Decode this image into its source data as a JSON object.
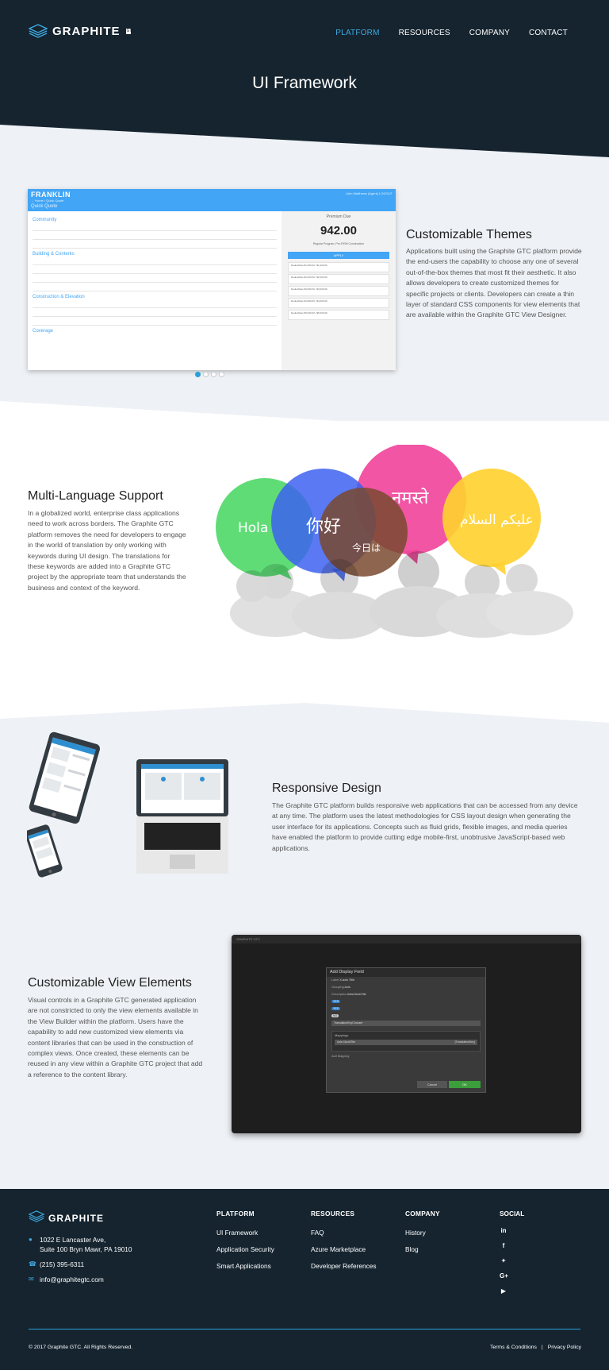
{
  "header": {
    "logo_text": "GRAPHITE",
    "logo_badge": "GTC",
    "nav": [
      "PLATFORM",
      "RESOURCES",
      "COMPANY",
      "CONTACT"
    ],
    "active_nav": "PLATFORM",
    "title": "UI Framework"
  },
  "themes": {
    "heading": "Customizable Themes",
    "body": "Applications built using the Graphite GTC platform provide the end-users the capability to choose any one of several out-of-the-box themes that most fit their aesthetic. It also allows developers to create customized themes for specific projects or clients. Developers can create a thin layer of standard CSS components for view elements that are available within the Graphite GTC View Designer.",
    "screen": {
      "brand": "FRANKLIN",
      "breadcrumb": "← Home / Quick Quote",
      "page": "Quick Quote",
      "user": "John Matthews (Agent)  LOGOUT",
      "sections": [
        "Community",
        "Building & Contents",
        "Construction & Elevation",
        "Coverage"
      ],
      "premium_label": "Premium Due",
      "premium_value": "942.00",
      "program": "Regular Program, Pre-FIRM Construction",
      "apply": "APPLY",
      "cards": [
        "Deductibles $1,000.00 / $1,000.00",
        "Deductibles $2,000.00 / $2,000.00",
        "Deductibles $3,000.00 / $3,000.00",
        "Deductibles $4,000.00 / $4,000.00",
        "Deductibles $5,000.00 / $5,000.00"
      ]
    },
    "carousel_active": 0,
    "carousel_count": 4
  },
  "language": {
    "heading": "Multi-Language Support",
    "body": "In a globalized world, enterprise class applications need to work across borders. The Graphite GTC platform removes the need for developers to engage in the world of translation by only working with keywords during UI design. The translations for these keywords are added into a Graphite GTC project by the appropriate team that understands the business and context of the keyword.",
    "bubbles": [
      "Hola",
      "你好",
      "今日は",
      "नमस्ते",
      "عليكم السلام"
    ]
  },
  "responsive": {
    "heading": "Responsive Design",
    "body": "The Graphite GTC platform builds responsive web applications that can be accessed from any device at any time. The platform uses the latest methodologies for CSS layout design when generating the user interface for its applications. Concepts such as fluid grids, flexible images, and media queries have enabled the platform to provide cutting edge mobile-first, unobtrusive JavaScript-based web applications."
  },
  "view_elements": {
    "heading": "Customizable View Elements",
    "body": "Visual controls in a Graphite GTC generated application are not constricted to only the view elements available in the View Builder within the platform. Users have the capability to add new customized view elements via content libraries that can be used in the construction of complex views. Once created, these elements can be reused in any view within a Graphite GTC project that add a reference to the content library.",
    "screen": {
      "app": "GRAPHITE GTC",
      "dialog_title": "Add Display Field",
      "fields": [
        {
          "label": "Label",
          "value": "X-axis Title"
        },
        {
          "label": "Grouping",
          "value": "Axis"
        },
        {
          "label": "Description",
          "value": "AxisXAxisTitle"
        }
      ],
      "affects_render": "YES",
      "localize": "YES",
      "default_value_applied": "NO",
      "editor_type": "TranslationKeyChooser",
      "mappings_label": "Mappings",
      "mapping_left": "Axis.XAxisTitle",
      "mapping_right": "{TranslationKey}",
      "add_mapping": "Add Mapping",
      "cancel": "Cancel",
      "ok": "OK"
    }
  },
  "footer": {
    "logo_text": "GRAPHITE",
    "address_line1": "1022 E Lancaster Ave,",
    "address_line2": "Suite 100 Bryn Mawr, PA 19010",
    "phone": "(215) 395-6311",
    "email": "info@graphitegtc.com",
    "columns": [
      {
        "title": "PLATFORM",
        "links": [
          "UI Framework",
          "Application Security",
          "Smart Applications"
        ]
      },
      {
        "title": "RESOURCES",
        "links": [
          "FAQ",
          "Azure Marketplace",
          "Developer References"
        ]
      },
      {
        "title": "COMPANY",
        "links": [
          "History",
          "Blog"
        ]
      }
    ],
    "social_title": "SOCIAL",
    "social": [
      "linkedin-icon",
      "facebook-icon",
      "twitter-icon",
      "google-plus-icon",
      "youtube-icon"
    ],
    "copyright": "© 2017 Graphite GTC. All Rights Reserved.",
    "terms": "Terms & Conditions",
    "separator": "|",
    "privacy": "Privacy Policy"
  },
  "colors": {
    "navy": "#15242f",
    "accent": "#3fa9e0",
    "light_band": "#eef1f5"
  }
}
